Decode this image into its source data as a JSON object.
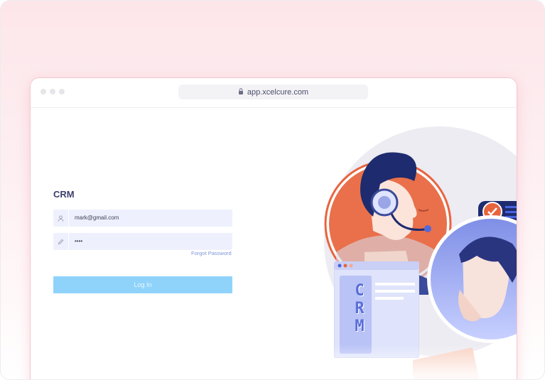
{
  "browser": {
    "url": "app.xcelcure.com"
  },
  "login": {
    "title": "CRM",
    "email_value": "mark@gmail.com",
    "password_value": "••••",
    "forgot_label": "Forgot Password",
    "login_label": "Log In"
  },
  "illustration": {
    "label": "CRM"
  },
  "colors": {
    "accent": "#8fd3fb",
    "title": "#3c3f6e",
    "illustration_orange": "#e8643f",
    "illustration_navy": "#1e2b6e"
  },
  "icons": [
    "lock-icon",
    "user-icon",
    "pencil-icon",
    "check-icon",
    "star-icon"
  ]
}
